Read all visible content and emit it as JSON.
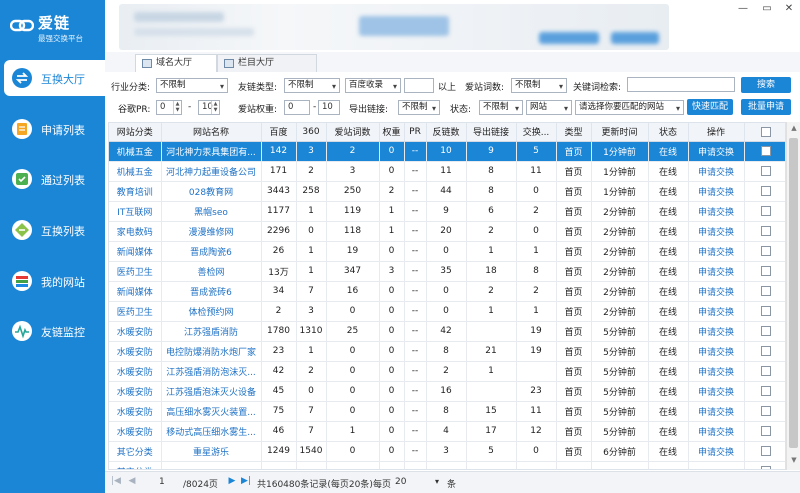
{
  "app": {
    "title": "爱链",
    "subtitle": "最强交换平台",
    "accent": "#1c86d6"
  },
  "nav": [
    {
      "label": "互换大厅",
      "icon": "exchange-hall-icon",
      "active": true
    },
    {
      "label": "申请列表",
      "icon": "apply-list-icon"
    },
    {
      "label": "通过列表",
      "icon": "approved-list-icon"
    },
    {
      "label": "互换列表",
      "icon": "swap-list-icon"
    },
    {
      "label": "我的网站",
      "icon": "my-sites-icon"
    },
    {
      "label": "友链监控",
      "icon": "link-monitor-icon"
    }
  ],
  "tabs": [
    {
      "label": "域名大厅"
    },
    {
      "label": "栏目大厅"
    }
  ],
  "filters": {
    "industry_label": "行业分类:",
    "industry_value": "不限制",
    "link_type_label": "友链类型:",
    "link_type_value": "不限制",
    "baidu_index_value": "百度收录",
    "above_label": "以上",
    "aizhan_words_label": "爱站词数:",
    "aizhan_words_value": "不限制",
    "keyword_label": "关键词检索:",
    "keyword_value": "",
    "search_button": "搜索",
    "google_pr_label": "谷歌PR:",
    "pr_from": "0",
    "pr_to": "10",
    "dash": "-",
    "aizhan_weight_label": "爱站权重:",
    "weight_from": "0",
    "weight_to": "10",
    "export_links_label": "导出链接:",
    "export_links_value": "不限制",
    "status_label": "状态:",
    "status_value": "不限制",
    "site_value": "网站",
    "match_select_value": "请选择你要匹配的网站",
    "quick_match_button": "快速匹配",
    "batch_apply_button": "批量申请"
  },
  "table": {
    "columns": [
      "网站分类",
      "网站名称",
      "百度",
      "360",
      "爱站词数",
      "权重",
      "PR",
      "反链数",
      "导出链接",
      "交换...",
      "类型",
      "更新时间",
      "状态",
      "操作",
      ""
    ],
    "rows": [
      [
        "机械五金",
        "河北神力汞具集团有...",
        "142",
        "3",
        "2",
        "0",
        "--",
        "10",
        "9",
        "5",
        "首页",
        "1分钟前",
        "在线",
        "申请交换"
      ],
      [
        "机械五金",
        "河北神力起重设备公司",
        "171",
        "2",
        "3",
        "0",
        "--",
        "11",
        "8",
        "11",
        "首页",
        "1分钟前",
        "在线",
        "申请交换"
      ],
      [
        "教育培训",
        "028教育网",
        "3443",
        "258",
        "250",
        "2",
        "--",
        "44",
        "8",
        "0",
        "首页",
        "1分钟前",
        "在线",
        "申请交换"
      ],
      [
        "IT互联网",
        "黑帽seo",
        "1177",
        "1",
        "119",
        "1",
        "--",
        "9",
        "6",
        "2",
        "首页",
        "2分钟前",
        "在线",
        "申请交换"
      ],
      [
        "家电数码",
        "漫漫维修网",
        "2296",
        "0",
        "118",
        "1",
        "--",
        "20",
        "2",
        "0",
        "首页",
        "2分钟前",
        "在线",
        "申请交换"
      ],
      [
        "新闻媒体",
        "晋成陶瓷6",
        "26",
        "1",
        "19",
        "0",
        "--",
        "0",
        "1",
        "1",
        "首页",
        "2分钟前",
        "在线",
        "申请交换"
      ],
      [
        "医药卫生",
        "善检网",
        "13万",
        "1",
        "347",
        "3",
        "--",
        "35",
        "18",
        "8",
        "首页",
        "2分钟前",
        "在线",
        "申请交换"
      ],
      [
        "新闻媒体",
        "晋成瓷砖6",
        "34",
        "7",
        "16",
        "0",
        "--",
        "0",
        "2",
        "2",
        "首页",
        "2分钟前",
        "在线",
        "申请交换"
      ],
      [
        "医药卫生",
        "体检预约网",
        "2",
        "3",
        "0",
        "0",
        "--",
        "0",
        "1",
        "1",
        "首页",
        "2分钟前",
        "在线",
        "申请交换"
      ],
      [
        "水暖安防",
        "江苏强盾消防",
        "1780",
        "1310",
        "25",
        "0",
        "--",
        "42",
        "",
        "19",
        "首页",
        "5分钟前",
        "在线",
        "申请交换"
      ],
      [
        "水暖安防",
        "电控防爆消防水炮厂家",
        "23",
        "1",
        "0",
        "0",
        "--",
        "8",
        "21",
        "19",
        "首页",
        "5分钟前",
        "在线",
        "申请交换"
      ],
      [
        "水暖安防",
        "江苏强盾消防泡沫灭...",
        "42",
        "2",
        "0",
        "0",
        "--",
        "2",
        "1",
        "",
        "首页",
        "5分钟前",
        "在线",
        "申请交换"
      ],
      [
        "水暖安防",
        "江苏强盾泡沫灭火设备",
        "45",
        "0",
        "0",
        "0",
        "--",
        "16",
        "",
        "23",
        "首页",
        "5分钟前",
        "在线",
        "申请交换"
      ],
      [
        "水暖安防",
        "高压细水雾灭火装置...",
        "75",
        "7",
        "0",
        "0",
        "--",
        "8",
        "15",
        "11",
        "首页",
        "5分钟前",
        "在线",
        "申请交换"
      ],
      [
        "水暖安防",
        "移动式高压细水雾生...",
        "46",
        "7",
        "1",
        "0",
        "--",
        "4",
        "17",
        "12",
        "首页",
        "5分钟前",
        "在线",
        "申请交换"
      ],
      [
        "其它分类",
        "重星游乐",
        "1249",
        "1540",
        "0",
        "0",
        "--",
        "3",
        "5",
        "0",
        "首页",
        "6分钟前",
        "在线",
        "申请交换"
      ],
      [
        "其它分类",
        "",
        "",
        "",
        "",
        "",
        "",
        "",
        "",
        "",
        "",
        "",
        "",
        ""
      ]
    ]
  },
  "pager": {
    "page": "1",
    "total_pages": "/8024页",
    "summary": "共160480条记录(每页20条)",
    "per_page_label": "每页",
    "per_page": "20",
    "unit": "条"
  }
}
